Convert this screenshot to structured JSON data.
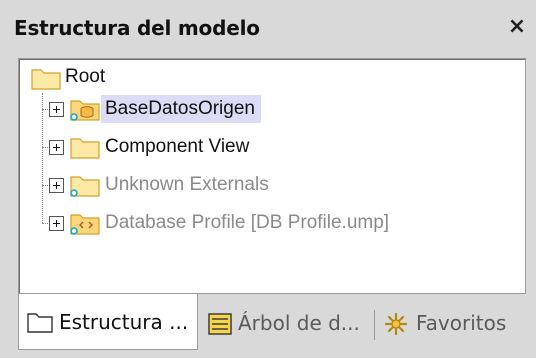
{
  "panel": {
    "title": "Estructura del modelo",
    "close_glyph": "×"
  },
  "tree": {
    "root": {
      "label": "Root",
      "icon": "folder-icon"
    },
    "items": [
      {
        "label": "BaseDatosOrigen",
        "icon": "database-folder-icon",
        "selected": true,
        "dimmed": false
      },
      {
        "label": "Component View",
        "icon": "folder-icon",
        "selected": false,
        "dimmed": false
      },
      {
        "label": "Unknown Externals",
        "icon": "linked-folder-icon",
        "selected": false,
        "dimmed": true
      },
      {
        "label": "Database Profile [DB Profile.ump]",
        "icon": "profile-folder-icon",
        "selected": false,
        "dimmed": true
      }
    ]
  },
  "tabs": [
    {
      "label": "Estructura ...",
      "icon": "folder-outline-icon",
      "active": true
    },
    {
      "label": "Árbol de d...",
      "icon": "diagram-tree-icon",
      "active": false
    },
    {
      "label": "Favoritos",
      "icon": "favorites-star-icon",
      "active": false
    }
  ],
  "colors": {
    "panel_bg": "#d9d9d9",
    "selection": "#dcdcf6",
    "folder_fill": "#fde9a6",
    "folder_stroke": "#d4a12a",
    "dim_text": "#8a8a8a"
  }
}
